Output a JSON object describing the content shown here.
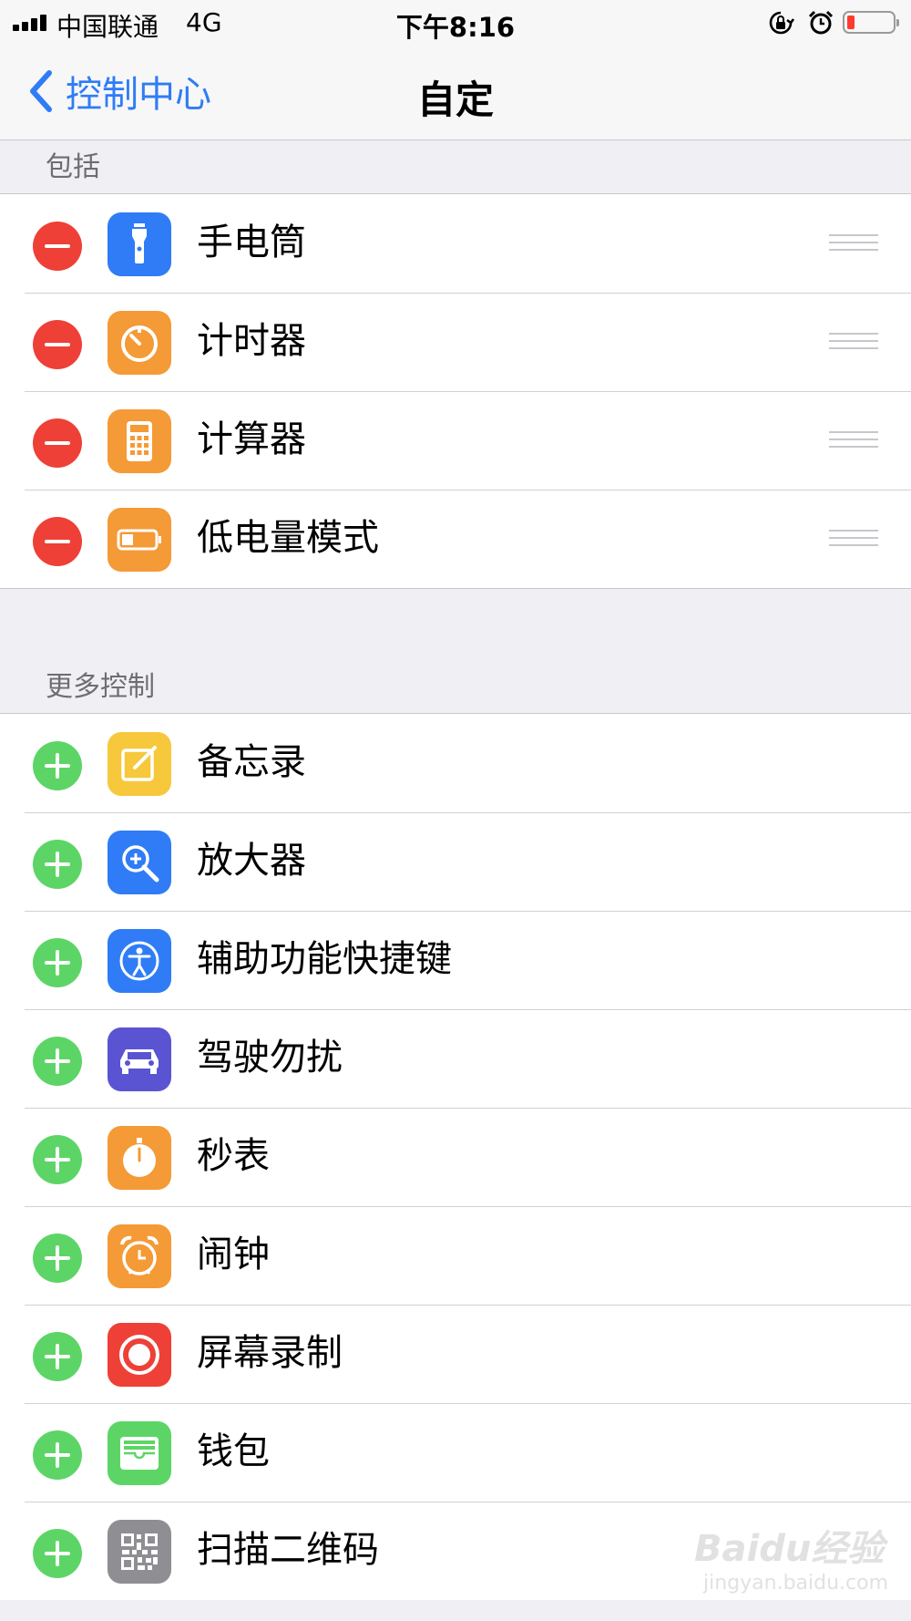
{
  "status_bar": {
    "carrier": "中国联通",
    "network": "4G",
    "time": "下午8:16",
    "battery_level": 0.15
  },
  "nav": {
    "back_label": "控制中心",
    "title": "自定"
  },
  "included": {
    "header": "包括",
    "items": [
      {
        "label": "手电筒",
        "icon": "flashlight-icon",
        "color": "#2f7cf6"
      },
      {
        "label": "计时器",
        "icon": "timer-icon",
        "color": "#f49a36"
      },
      {
        "label": "计算器",
        "icon": "calculator-icon",
        "color": "#f49a36"
      },
      {
        "label": "低电量模式",
        "icon": "low-power-mode-icon",
        "color": "#f49a36"
      }
    ]
  },
  "more": {
    "header": "更多控制",
    "items": [
      {
        "label": "备忘录",
        "icon": "notes-icon",
        "color": "#f7c83c"
      },
      {
        "label": "放大器",
        "icon": "magnifier-icon",
        "color": "#2f7cf6"
      },
      {
        "label": "辅助功能快捷键",
        "icon": "accessibility-icon",
        "color": "#2f7cf6"
      },
      {
        "label": "驾驶勿扰",
        "icon": "car-icon",
        "color": "#5a54d3"
      },
      {
        "label": "秒表",
        "icon": "stopwatch-icon",
        "color": "#f49a36"
      },
      {
        "label": "闹钟",
        "icon": "alarm-clock-icon",
        "color": "#f49a36"
      },
      {
        "label": "屏幕录制",
        "icon": "screen-recording-icon",
        "color": "#ee4037"
      },
      {
        "label": "钱包",
        "icon": "wallet-icon",
        "color": "#5dd566"
      },
      {
        "label": "扫描二维码",
        "icon": "qr-code-icon",
        "color": "#8e8e93"
      }
    ]
  },
  "watermark": {
    "main": "Baidu经验",
    "sub": "jingyan.baidu.com"
  }
}
